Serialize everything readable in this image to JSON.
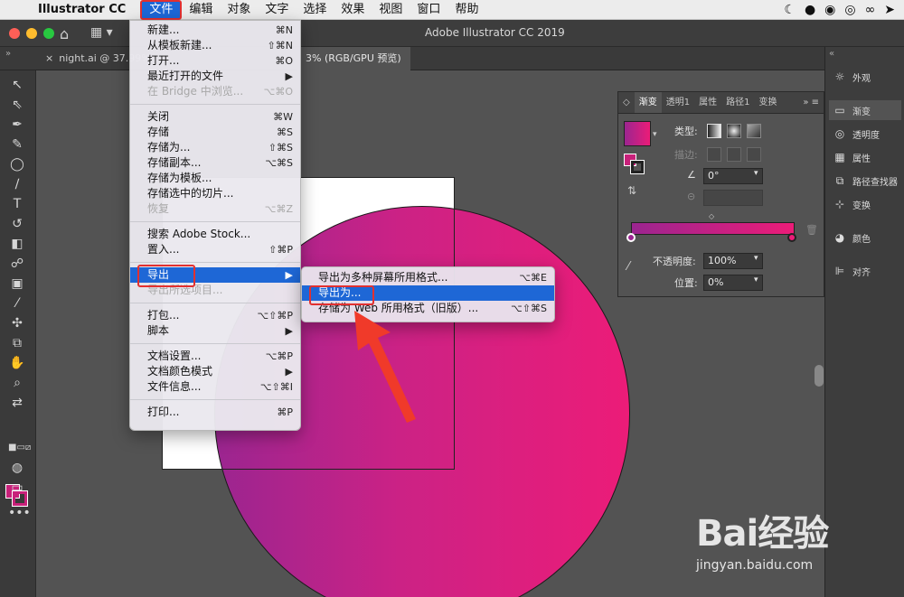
{
  "menubar": {
    "app_name": "Illustrator CC",
    "items": [
      "文件",
      "编辑",
      "对象",
      "文字",
      "选择",
      "效果",
      "视图",
      "窗口",
      "帮助"
    ]
  },
  "window": {
    "title": "Adobe Illustrator CC 2019"
  },
  "tabs": [
    {
      "label": "night.ai @ 37.99%"
    },
    {
      "label": "3% (RGB/GPU 预览)"
    }
  ],
  "file_menu": {
    "groups": [
      [
        {
          "label": "新建...",
          "shortcut": "⌘N"
        },
        {
          "label": "从模板新建...",
          "shortcut": "⇧⌘N"
        },
        {
          "label": "打开...",
          "shortcut": "⌘O"
        },
        {
          "label": "最近打开的文件",
          "shortcut": "▶"
        },
        {
          "label": "在 Bridge 中浏览...",
          "shortcut": "⌥⌘O",
          "disabled": true
        }
      ],
      [
        {
          "label": "关闭",
          "shortcut": "⌘W"
        },
        {
          "label": "存储",
          "shortcut": "⌘S"
        },
        {
          "label": "存储为...",
          "shortcut": "⇧⌘S"
        },
        {
          "label": "存储副本...",
          "shortcut": "⌥⌘S"
        },
        {
          "label": "存储为模板...",
          "shortcut": ""
        },
        {
          "label": "存储选中的切片...",
          "shortcut": ""
        },
        {
          "label": "恢复",
          "shortcut": "⌥⌘Z",
          "disabled": true
        }
      ],
      [
        {
          "label": "搜索 Adobe Stock...",
          "shortcut": ""
        },
        {
          "label": "置入...",
          "shortcut": "⇧⌘P"
        }
      ],
      [
        {
          "label": "导出",
          "shortcut": "▶",
          "highlight": true
        },
        {
          "label": "导出所选项目...",
          "shortcut": "",
          "disabled": true
        }
      ],
      [
        {
          "label": "打包...",
          "shortcut": "⌥⇧⌘P"
        },
        {
          "label": "脚本",
          "shortcut": "▶"
        }
      ],
      [
        {
          "label": "文档设置...",
          "shortcut": "⌥⌘P"
        },
        {
          "label": "文档颜色模式",
          "shortcut": "▶"
        },
        {
          "label": "文件信息...",
          "shortcut": "⌥⇧⌘I"
        }
      ],
      [
        {
          "label": "打印...",
          "shortcut": "⌘P"
        }
      ]
    ]
  },
  "export_submenu": [
    {
      "label": "导出为多种屏幕所用格式...",
      "shortcut": "⌥⌘E"
    },
    {
      "label": "导出为...",
      "shortcut": "",
      "highlight": true
    },
    {
      "label": "存储为 Web 所用格式（旧版）...",
      "shortcut": "⌥⇧⌘S"
    }
  ],
  "gradient_panel": {
    "tabs": [
      "渐变",
      "透明1",
      "属性",
      "路径1",
      "变换"
    ],
    "type_label": "类型:",
    "stroke_label": "描边:",
    "angle_value": "0°",
    "opacity_label": "不透明度:",
    "opacity_value": "100%",
    "location_label": "位置:",
    "location_value": "0%",
    "gradient_start": "#9b2590",
    "gradient_end": "#ec1c78"
  },
  "right_strip": {
    "items": [
      {
        "label": "外观",
        "icon": "sun-icon"
      },
      {
        "label": "渐变",
        "icon": "gradient-icon",
        "active": true
      },
      {
        "label": "透明度",
        "icon": "circles-icon"
      },
      {
        "label": "属性",
        "icon": "grid-icon"
      },
      {
        "label": "路径查找器",
        "icon": "squares-icon"
      },
      {
        "label": "变换",
        "icon": "transform-icon"
      },
      {
        "label": "颜色",
        "icon": "palette-icon"
      },
      {
        "label": "对齐",
        "icon": "align-icon"
      }
    ]
  },
  "watermark": {
    "main": "Bai经验",
    "sub": "jingyan.baidu.com"
  },
  "colors": {
    "accent": "#1e67d6",
    "highlight_box": "#e23030",
    "fill": "#c8217a"
  }
}
